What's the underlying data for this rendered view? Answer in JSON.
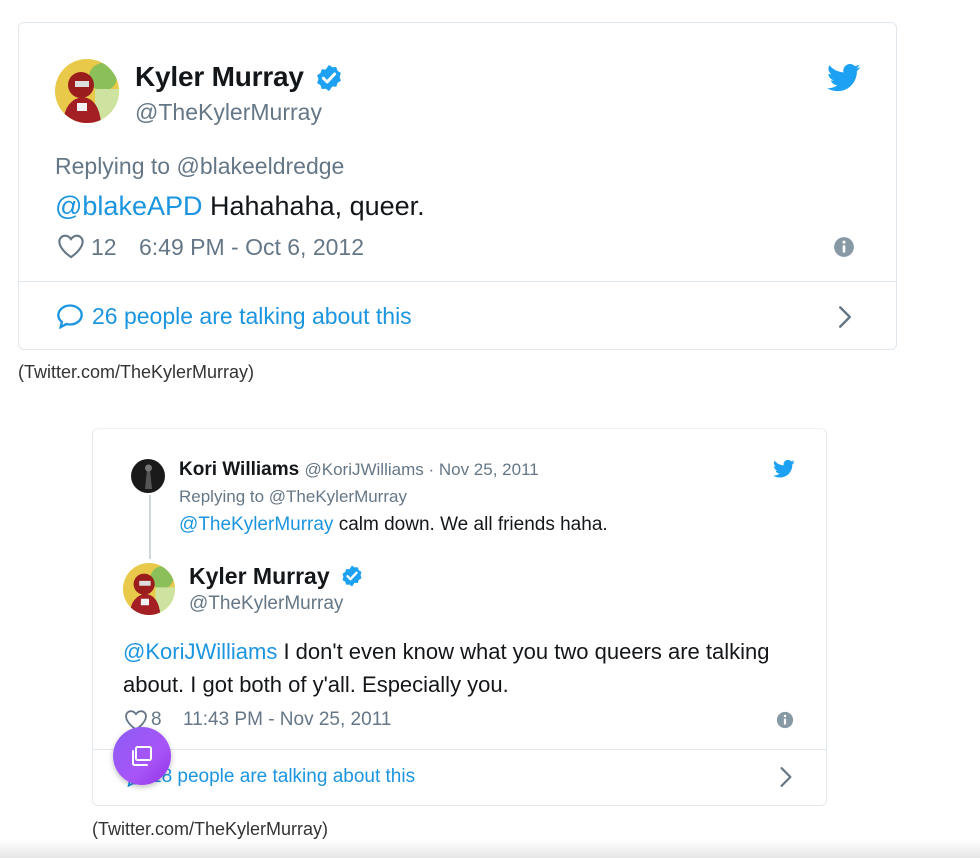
{
  "tweet1": {
    "name": "Kyler Murray",
    "handle": "@TheKylerMurray",
    "replying_prefix": "Replying to ",
    "replying_to": "@blakeeldredge",
    "mention": "@blakeAPD",
    "text": " Hahahaha, queer.",
    "likes": "12",
    "timestamp": "6:49 PM - Oct 6, 2012",
    "talking": "26 people are talking about this",
    "icons": [
      "verified-icon",
      "twitter-bird-icon",
      "heart-icon",
      "info-icon",
      "comment-bubble-icon",
      "chevron-right-icon"
    ]
  },
  "caption1": "(Twitter.com/TheKylerMurray)",
  "tweet2": {
    "parent": {
      "name": "Kori Williams",
      "handle_date": "@KoriJWilliams · Nov 25, 2011",
      "replying_prefix": "Replying to ",
      "replying_to": "@TheKylerMurray",
      "mention": "@TheKylerMurray",
      "text": " calm down. We all friends haha."
    },
    "name": "Kyler Murray",
    "handle": "@TheKylerMurray",
    "mention": "@KoriJWilliams",
    "text": " I don't even know what you two queers are talking about. I got both of y'all. Especially you.",
    "likes": "8",
    "timestamp": "11:43 PM - Nov 25, 2011",
    "talking": "18 people are talking about this"
  },
  "caption2": "(Twitter.com/TheKylerMurray)",
  "colors": {
    "link_blue": "#1b95e0",
    "meta_grey": "#657786",
    "verified_blue": "#1da1f2",
    "float_button": "#9b5cf6"
  }
}
